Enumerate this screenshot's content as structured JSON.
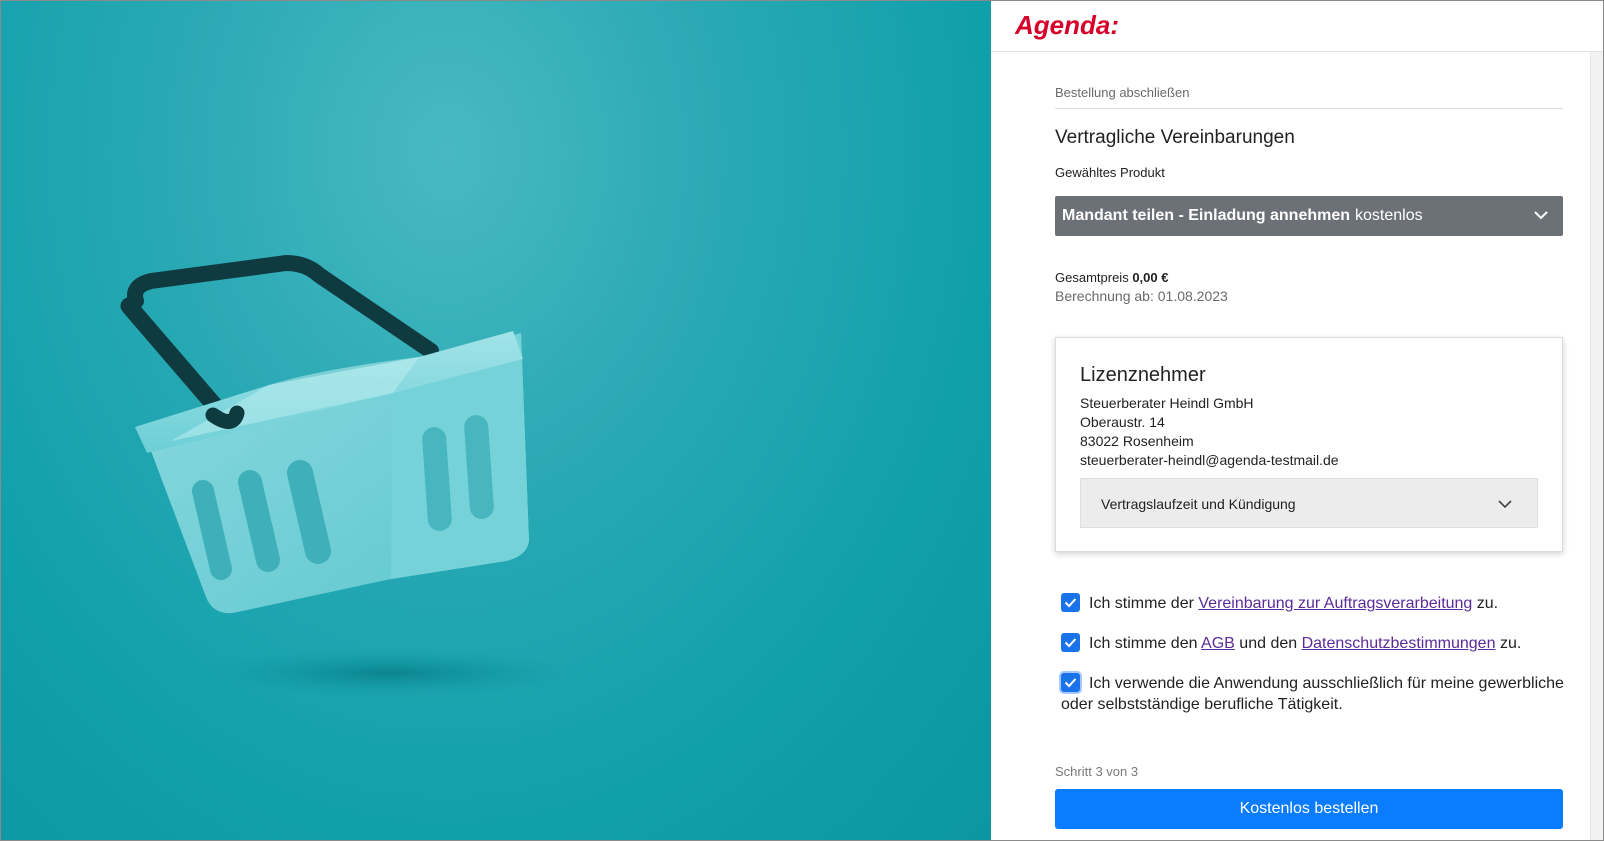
{
  "brand": {
    "logo_text": "Agenda:",
    "logo_color": "#d6002a"
  },
  "checkout": {
    "step_title": "Bestellung abschließen",
    "section_heading": "Vertragliche Vereinbarungen",
    "product_label": "Gewähltes Produkt",
    "product_name": "Mandant teilen - Einladung annehmen",
    "product_price": "kostenlos",
    "total_label": "Gesamtpreis",
    "total_value": "0,00 €",
    "billing_date": "Berechnung ab: 01.08.2023"
  },
  "licensee": {
    "title": "Lizenznehmer",
    "address_lines": [
      "Steuerberater Heindl GmbH",
      "Oberaustr. 14",
      "83022 Rosenheim",
      "steuerberater-heindl@agenda-testmail.de"
    ],
    "term_accordion_label": "Vertragslaufzeit und Kündigung"
  },
  "consents": [
    {
      "checked": true,
      "prefix": "Ich stimme der",
      "link": "Vereinbarung zur Auftragsverarbeitung",
      "suffix": "zu."
    },
    {
      "checked": true,
      "prefix": "Ich stimme den",
      "link1": "AGB",
      "middle": "und den",
      "link2": "Datenschutzbestimmungen",
      "suffix": "zu."
    },
    {
      "checked": true,
      "line1": "Ich verwende die Anwendung ausschließlich für meine gewerbliche",
      "line2": "oder selbstständige berufliche Tätigkeit."
    }
  ],
  "footer": {
    "step_progress": "Schritt 3 von 3",
    "order_button": "Kostenlos bestellen"
  },
  "colors": {
    "hero_bg": "#10a0ab",
    "primary_button": "#0a7cff",
    "checkbox": "#1a73e8",
    "product_select_bg": "#6c7178",
    "link": "#5b2b99"
  },
  "icons": {
    "hero": "shopping-basket-illustration",
    "select_chevron": "chevron-down-icon",
    "checkbox": "checkmark-icon"
  }
}
